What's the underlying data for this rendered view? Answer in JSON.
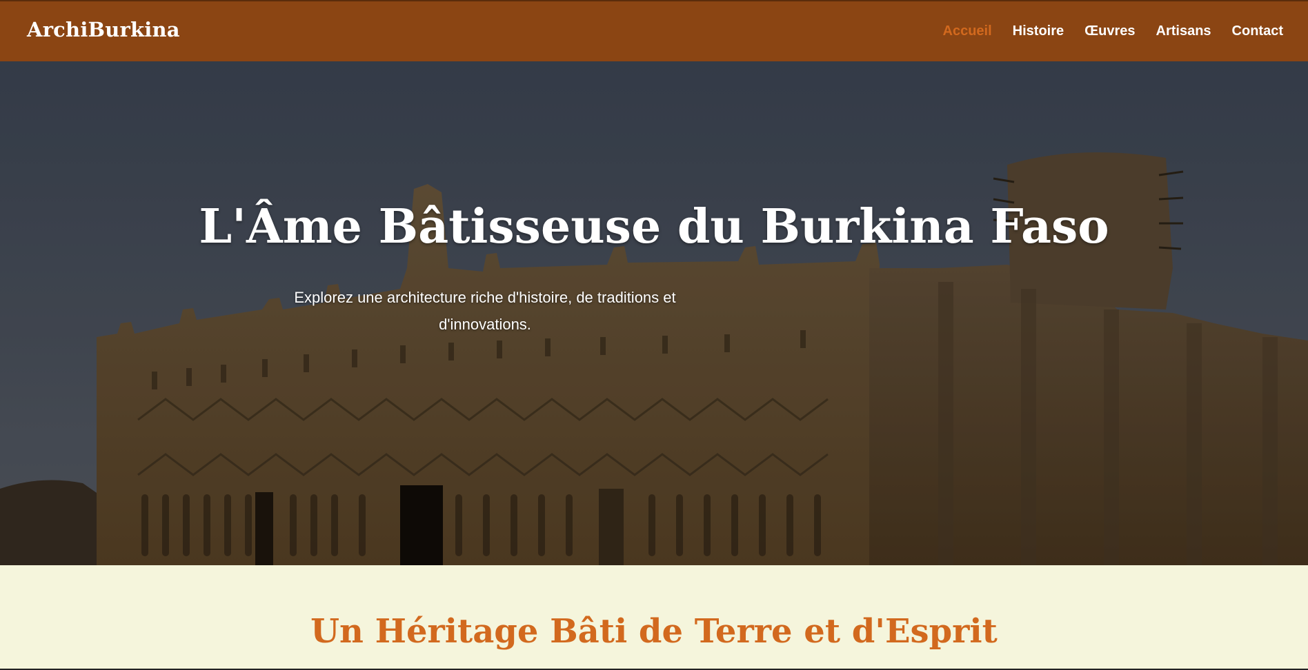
{
  "brand": "ArchiBurkina",
  "nav": {
    "items": [
      {
        "label": "Accueil",
        "active": true
      },
      {
        "label": "Histoire",
        "active": false
      },
      {
        "label": "Œuvres",
        "active": false
      },
      {
        "label": "Artisans",
        "active": false
      },
      {
        "label": "Contact",
        "active": false
      }
    ]
  },
  "hero": {
    "title": "L'Âme Bâtisseuse du Burkina Faso",
    "subtitle": "Explorez une architecture riche d'histoire, de traditions et d'innovations.",
    "image_semantic": "earthen-mosque-photo"
  },
  "section": {
    "title": "Un Héritage Bâti de Terre et d'Esprit"
  },
  "colors": {
    "header_bg": "#8b4513",
    "accent": "#d2691e",
    "section_bg": "#f5f5dc"
  }
}
